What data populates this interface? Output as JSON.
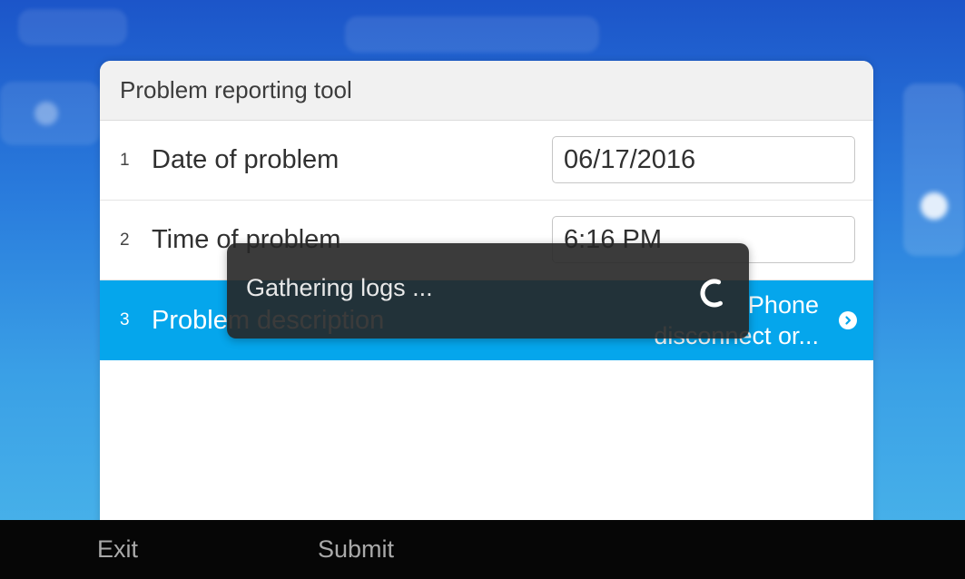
{
  "dialog": {
    "title": "Problem reporting tool",
    "rows": [
      {
        "number": "1",
        "label": "Date of problem",
        "value": "06/17/2016"
      },
      {
        "number": "2",
        "label": "Time of problem",
        "value": "6:16 PM"
      },
      {
        "number": "3",
        "label": "Problem description",
        "value_line1": "Phone",
        "value_line2": "disconnect or..."
      }
    ]
  },
  "toast": {
    "message": "Gathering logs ..."
  },
  "softkeys": {
    "exit": "Exit",
    "submit": "Submit"
  },
  "colors": {
    "selected_row": "#05a6ec",
    "softkey_bar": "#060606",
    "background_top": "#1c55c9",
    "background_bottom": "#4bb6ea"
  },
  "icons": {
    "row_chevron": "chevron-right-icon",
    "loading": "spinner-icon"
  }
}
